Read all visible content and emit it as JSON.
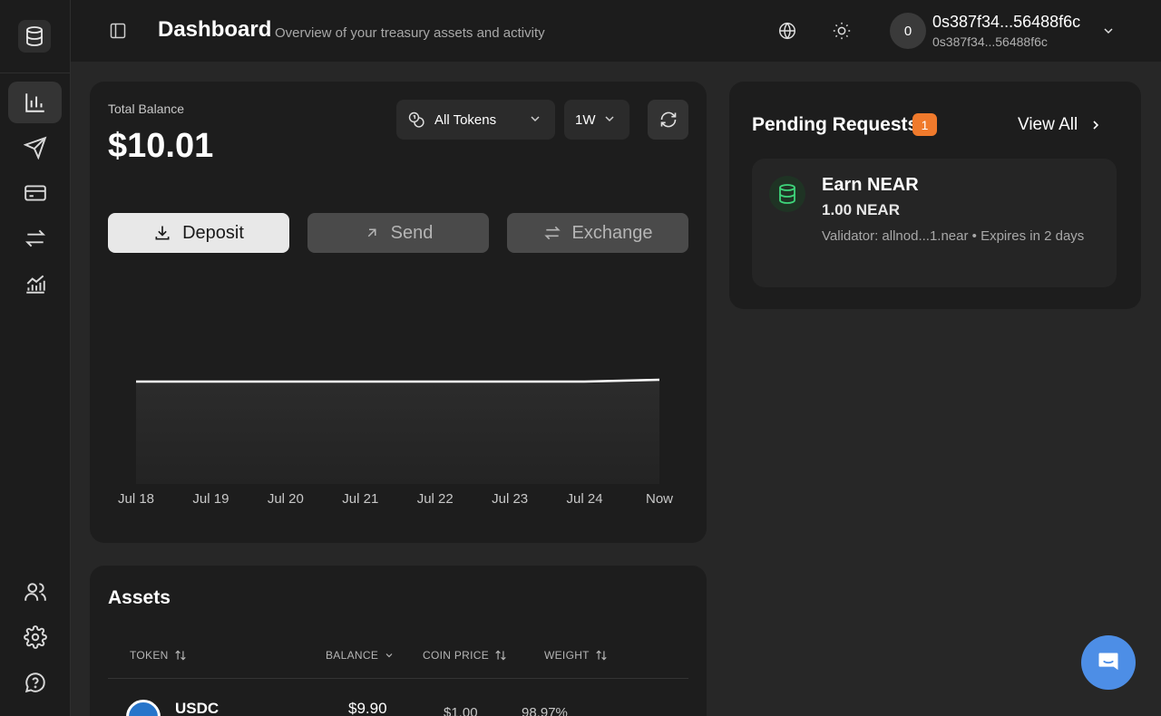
{
  "header": {
    "title": "Dashboard",
    "subtitle": "Overview of your treasury assets and activity",
    "account": {
      "avatar_initial": "0",
      "name": "0s387f34...56488f6c",
      "sub": "0s387f34...56488f6c"
    }
  },
  "sidebar": {
    "items": [
      {
        "icon": "dashboard-chart-icon",
        "active": true
      },
      {
        "icon": "send-paper-plane-icon"
      },
      {
        "icon": "card-icon"
      },
      {
        "icon": "exchange-arrows-icon"
      },
      {
        "icon": "trending-chart-icon"
      },
      {
        "icon": "users-icon"
      },
      {
        "icon": "gear-icon"
      },
      {
        "icon": "help-icon"
      }
    ]
  },
  "balance": {
    "label": "Total Balance",
    "value": "$10.01",
    "token_filter": "All Tokens",
    "period": "1W",
    "actions": {
      "deposit": "Deposit",
      "send": "Send",
      "exchange": "Exchange"
    }
  },
  "chart_data": {
    "type": "area",
    "x": [
      "Jul 18",
      "Jul 19",
      "Jul 20",
      "Jul 21",
      "Jul 22",
      "Jul 23",
      "Jul 24",
      "Now"
    ],
    "series": [
      {
        "values": [
          10.0,
          10.0,
          10.0,
          10.0,
          10.0,
          10.0,
          10.0,
          10.01
        ]
      }
    ],
    "title": "",
    "xlabel": "",
    "ylabel": "",
    "grid": false
  },
  "assets": {
    "title": "Assets",
    "columns": [
      "TOKEN",
      "BALANCE",
      "COIN PRICE",
      "WEIGHT"
    ],
    "rows": [
      {
        "token": "USDC",
        "balance": "$9.90",
        "price": "$1.00",
        "weight": "98.97%"
      }
    ]
  },
  "pending": {
    "title": "Pending Requests",
    "count": "1",
    "view_all": "View All",
    "requests": [
      {
        "title": "Earn NEAR",
        "amount": "1.00 NEAR",
        "detail": "Validator: allnod...1.near • Expires in 2 days"
      }
    ]
  },
  "colors": {
    "accent_orange": "#f07a2c",
    "chat_blue": "#4d8ee6",
    "earn_green": "#3ed47a"
  }
}
